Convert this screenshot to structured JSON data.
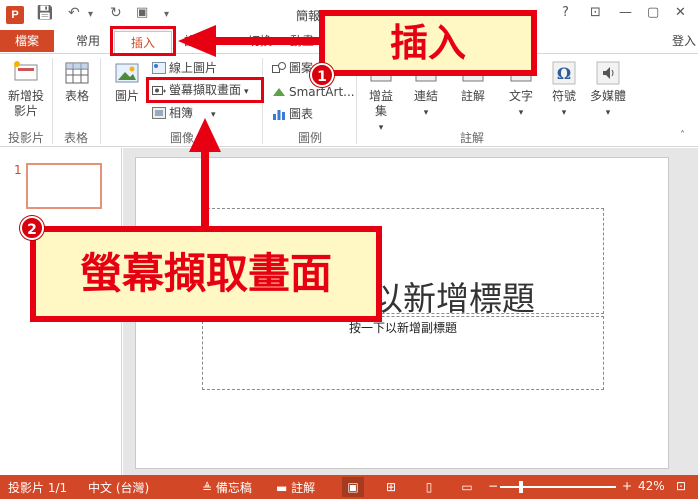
{
  "titlebar": {
    "app_icon": "P",
    "title": "簡報",
    "buttons": [
      "?",
      "⊡",
      "—",
      "▢",
      "✕"
    ]
  },
  "tabs": {
    "file": "檔案",
    "home": "常用",
    "insert": "插入",
    "design_partial": "設",
    "transitions_partial": "切換",
    "animations_partial": "動畫",
    "login": "登入"
  },
  "ribbon": {
    "new_slide": "新增投影片",
    "table": "表格",
    "picture": "圖片",
    "online_picture": "線上圖片",
    "screenshot": "螢幕擷取畫面",
    "album": "相簿",
    "shapes": "圖案",
    "smartart": "SmartArt...",
    "chart": "圖表",
    "addins": "增益集",
    "links": "連結",
    "comment": "註解",
    "text": "文字",
    "symbols": "符號",
    "media": "多媒體",
    "groups": {
      "slides": "投影片",
      "tables": "表格",
      "images": "圖像",
      "illustrations": "圖例",
      "comments": "註解"
    }
  },
  "slides": {
    "thumbnail_number": "1",
    "title_placeholder": "按一下以新增標題",
    "subtitle_placeholder": "按一下以新增副標題"
  },
  "statusbar": {
    "slide_count": "投影片 1/1",
    "language": "中文 (台灣)",
    "notes": "備忘稿",
    "comments": "註解",
    "zoom": "42%",
    "zoom_fraction": 0.42
  },
  "annotations": {
    "callout_insert": "插入",
    "callout_screenshot": "螢幕擷取畫面",
    "step1": "1",
    "step2": "2",
    "accent_color": "#e60012",
    "callout_fill": "#fff8c4"
  },
  "colors": {
    "brand": "#d24726"
  }
}
